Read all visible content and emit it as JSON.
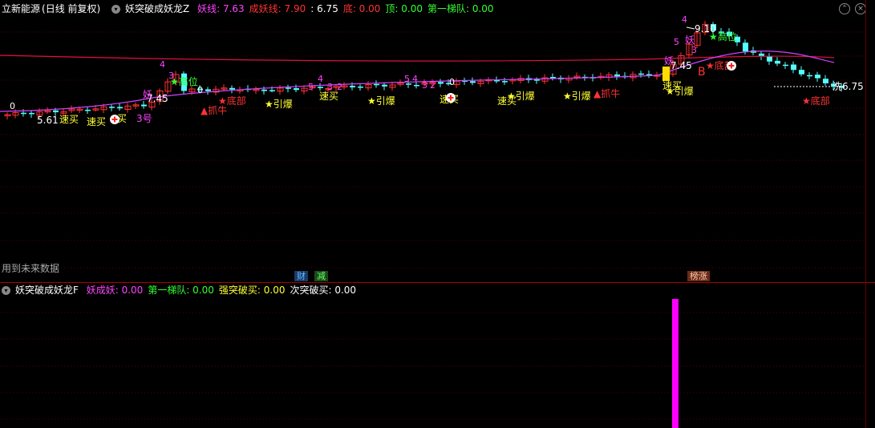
{
  "main_header": {
    "stock_name": "立新能源",
    "period": "(日线 前复权)",
    "indicator": "妖突破成妖龙Z",
    "fields": [
      {
        "label": "妖线:",
        "value": "7.63",
        "color": "#ff44ff"
      },
      {
        "label": "成妖线:",
        "value": "7.90",
        "color": "#ff3333"
      },
      {
        "label": ":",
        "value": "6.75",
        "color": "#ffffff"
      },
      {
        "label": "底:",
        "value": "0.00",
        "color": "#ff3333"
      },
      {
        "label": "顶:",
        "value": "0.00",
        "color": "#33ff33"
      },
      {
        "label": "第一梯队:",
        "value": "0.00",
        "color": "#33ff33"
      }
    ]
  },
  "future_data_note": "用到未来数据",
  "tags": [
    {
      "text": "财",
      "bg": "#1a3a6a",
      "color": "#66bbff"
    },
    {
      "text": "减",
      "bg": "#1a4a1a",
      "color": "#66ff66"
    },
    {
      "text": "榜涨",
      "bg": "#6a2a1a",
      "color": "#ffccaa"
    }
  ],
  "sub_header": {
    "indicator": "妖突破成妖龙F",
    "fields": [
      {
        "label": "妖成妖:",
        "value": "0.00",
        "color": "#ff44ff"
      },
      {
        "label": "第一梯队:",
        "value": "0.00",
        "color": "#33ff33"
      },
      {
        "label": "强突破买:",
        "value": "0.00",
        "color": "#ffff33"
      },
      {
        "label": "次突破买:",
        "value": "0.00",
        "color": "#ffffff"
      }
    ]
  },
  "colors": {
    "up": "#ff3333",
    "down": "#54ffff",
    "ma_red": "#dd1144",
    "ma_purple": "#cc44ff",
    "signal_yellow": "#ffff33",
    "signal_red": "#ff3333",
    "signal_green": "#33ff33",
    "signal_magenta": "#ff44ff",
    "sub_bar": "#ff00ff",
    "grid": "#550000"
  },
  "price_labels": {
    "high": "9.10",
    "level_left": "5.61",
    "level_mid": "7.45",
    "level_right": "7.45",
    "close_label": "洗6.75",
    "zero": "0"
  },
  "signal_labels": {
    "fast_buy": "速买",
    "ignite": "★引爆",
    "catch_bull": "▲抓牛",
    "bottom": "★底部",
    "high_pos": "★高位",
    "demon": "妖",
    "buy_tag": "买",
    "b_tag": "B",
    "no3": "3号"
  },
  "digit_labels": [
    "4",
    "3",
    "5",
    "2",
    "0"
  ]
}
